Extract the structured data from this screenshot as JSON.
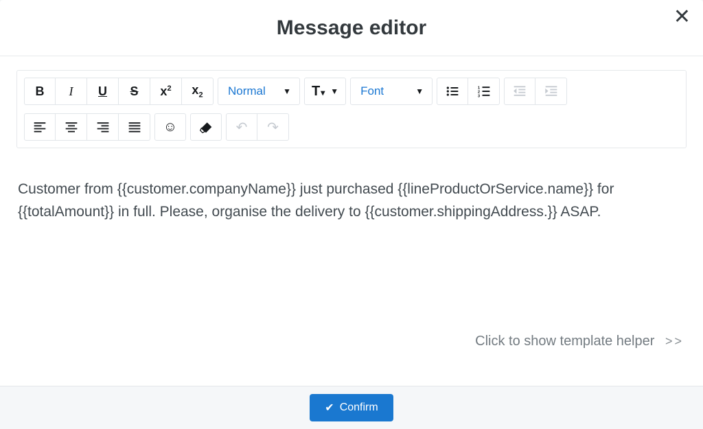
{
  "header": {
    "title": "Message editor"
  },
  "toolbar": {
    "bold": {
      "label": "B"
    },
    "italic": {
      "label": "I"
    },
    "underline": {
      "label": "U"
    },
    "strike": {
      "label": "S"
    },
    "superscript": {
      "label": "x"
    },
    "subscript": {
      "label": "x"
    },
    "paragraph_style": {
      "selected": "Normal"
    },
    "font_size": {
      "label": "T"
    },
    "font_family": {
      "selected": "Font"
    }
  },
  "content": {
    "text": "Customer from {{customer.companyName}} just purchased {{lineProductOrService.name}} for {{totalAmount}} in full. Please, organise the delivery to {{customer.shippingAddress.}} ASAP."
  },
  "helper": {
    "label": "Click to show template helper",
    "chevrons": ">>"
  },
  "footer": {
    "confirm_label": "Confirm"
  }
}
